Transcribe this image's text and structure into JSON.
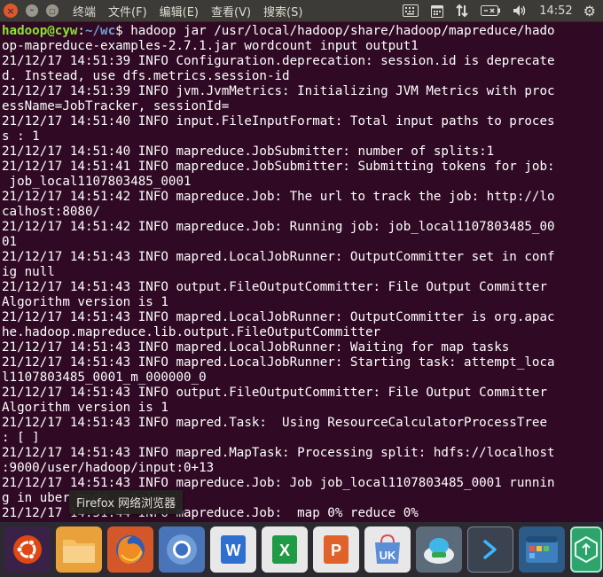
{
  "topbar": {
    "app_name": "终端",
    "menu": [
      "文件(F)",
      "编辑(E)",
      "查看(V)",
      "搜索(S)"
    ],
    "clock": "14:52"
  },
  "terminal": {
    "prompt_user": "hadoop@cyw",
    "prompt_sep": ":",
    "prompt_path": "~/wc",
    "prompt_symbol": "$ ",
    "command_lines": [
      "hadoop jar /usr/local/hadoop/share/hadoop/mapreduce/hado",
      "op-mapreduce-examples-2.7.1.jar wordcount input output1"
    ],
    "lines": [
      "21/12/17 14:51:39 INFO Configuration.deprecation: session.id is deprecate",
      "d. Instead, use dfs.metrics.session-id",
      "21/12/17 14:51:39 INFO jvm.JvmMetrics: Initializing JVM Metrics with proc",
      "essName=JobTracker, sessionId=",
      "21/12/17 14:51:40 INFO input.FileInputFormat: Total input paths to proces",
      "s : 1",
      "21/12/17 14:51:40 INFO mapreduce.JobSubmitter: number of splits:1",
      "21/12/17 14:51:41 INFO mapreduce.JobSubmitter: Submitting tokens for job:",
      " job_local1107803485_0001",
      "21/12/17 14:51:42 INFO mapreduce.Job: The url to track the job: http://lo",
      "calhost:8080/",
      "21/12/17 14:51:42 INFO mapreduce.Job: Running job: job_local1107803485_00",
      "01",
      "21/12/17 14:51:43 INFO mapred.LocalJobRunner: OutputCommitter set in conf",
      "ig null",
      "21/12/17 14:51:43 INFO output.FileOutputCommitter: File Output Committer",
      "Algorithm version is 1",
      "21/12/17 14:51:43 INFO mapred.LocalJobRunner: OutputCommitter is org.apac",
      "he.hadoop.mapreduce.lib.output.FileOutputCommitter",
      "21/12/17 14:51:43 INFO mapred.LocalJobRunner: Waiting for map tasks",
      "21/12/17 14:51:43 INFO mapred.LocalJobRunner: Starting task: attempt_loca",
      "l1107803485_0001_m_000000_0",
      "21/12/17 14:51:43 INFO output.FileOutputCommitter: File Output Committer",
      "Algorithm version is 1",
      "21/12/17 14:51:43 INFO mapred.Task:  Using ResourceCalculatorProcessTree",
      ": [ ]",
      "21/12/17 14:51:43 INFO mapred.MapTask: Processing split: hdfs://localhost",
      ":9000/user/hadoop/input:0+13",
      "21/12/17 14:51:43 INFO mapreduce.Job: Job job_local1107803485_0001 runnin",
      "g in uber mode : false",
      "21/12/17 14:51:44 INFO mapreduce.Job:  map 0% reduce 0%"
    ]
  },
  "tooltip": {
    "text": "Firefox 网络浏览器"
  },
  "launcher": {
    "items": [
      {
        "id": "dash",
        "icon": "ubuntu-logo-icon"
      },
      {
        "id": "files",
        "icon": "folder-icon"
      },
      {
        "id": "firefox",
        "icon": "firefox-icon"
      },
      {
        "id": "chromium",
        "icon": "chromium-icon"
      },
      {
        "id": "word",
        "icon": "wps-writer-icon",
        "glyph": "W"
      },
      {
        "id": "excel",
        "icon": "wps-spreadsheet-icon",
        "glyph": "X"
      },
      {
        "id": "ppt",
        "icon": "wps-presentation-icon",
        "glyph": "P"
      },
      {
        "id": "uk",
        "icon": "ubuntu-kylin-icon",
        "glyph": "UK"
      },
      {
        "id": "sw",
        "icon": "software-center-icon"
      },
      {
        "id": "terminal",
        "icon": "terminal-icon"
      },
      {
        "id": "workspace",
        "icon": "workspace-switcher-icon"
      },
      {
        "id": "cutoff",
        "icon": "app-icon"
      }
    ]
  },
  "colors": {
    "terminal_bg": "#300a24",
    "prompt_user": "#8ae234",
    "prompt_path": "#729fcf",
    "panel_bg": "#3c3b37",
    "launcher_bg": "#2c2a30"
  }
}
